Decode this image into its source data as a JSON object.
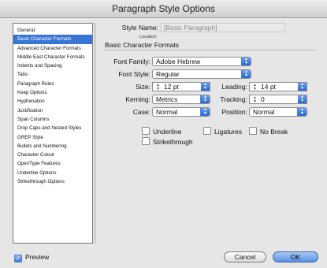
{
  "window": {
    "title": "Paragraph Style Options"
  },
  "sidebar": {
    "items": [
      {
        "label": "General",
        "selected": false
      },
      {
        "label": "Basic Character Formats",
        "selected": true
      },
      {
        "label": "Advanced Character Formats",
        "selected": false
      },
      {
        "label": "Middle East Character Formats",
        "selected": false
      },
      {
        "label": "Indents and Spacing",
        "selected": false
      },
      {
        "label": "Tabs",
        "selected": false
      },
      {
        "label": "Paragraph Rules",
        "selected": false
      },
      {
        "label": "Keep Options",
        "selected": false
      },
      {
        "label": "Hyphenation",
        "selected": false
      },
      {
        "label": "Justification",
        "selected": false
      },
      {
        "label": "Span Columns",
        "selected": false
      },
      {
        "label": "Drop Caps and Nested Styles",
        "selected": false
      },
      {
        "label": "GREP Style",
        "selected": false
      },
      {
        "label": "Bullets and Numbering",
        "selected": false
      },
      {
        "label": "Character Colour",
        "selected": false
      },
      {
        "label": "OpenType Features",
        "selected": false
      },
      {
        "label": "Underline Options",
        "selected": false
      },
      {
        "label": "Strikethrough Options",
        "selected": false
      }
    ]
  },
  "header": {
    "style_name_label": "Style Name:",
    "style_name_value": "[Basic Paragraph]",
    "location_label": "Location:",
    "section_title": "Basic Character Formats"
  },
  "form": {
    "font_family": {
      "label": "Font Family:",
      "value": "Adobe Hebrew"
    },
    "font_style": {
      "label": "Font Style:",
      "value": "Regular"
    },
    "size": {
      "label": "Size:",
      "value": "12 pt"
    },
    "leading": {
      "label": "Leading:",
      "value": "14 pt"
    },
    "kerning": {
      "label": "Kerning:",
      "value": "Metrics"
    },
    "tracking": {
      "label": "Tracking:",
      "value": "0"
    },
    "case": {
      "label": "Case:",
      "value": "Normal"
    },
    "position": {
      "label": "Position:",
      "value": "Normal"
    }
  },
  "checkboxes": {
    "underline": {
      "label": "Underline",
      "checked": false
    },
    "ligatures": {
      "label": "Ligatures",
      "checked": false
    },
    "no_break": {
      "label": "No Break",
      "checked": false
    },
    "strikethrough": {
      "label": "Strikethrough",
      "checked": false
    }
  },
  "footer": {
    "preview": {
      "label": "Preview",
      "checked": true
    },
    "cancel_label": "Cancel",
    "ok_label": "OK"
  },
  "icons": {
    "select_arrows": "up-down-arrows-icon",
    "spinner": "spinner-arrows-icon",
    "checkmark": "checkmark-icon"
  },
  "colors": {
    "accent": "#3875d7",
    "ok_button": "#5a91e4"
  }
}
